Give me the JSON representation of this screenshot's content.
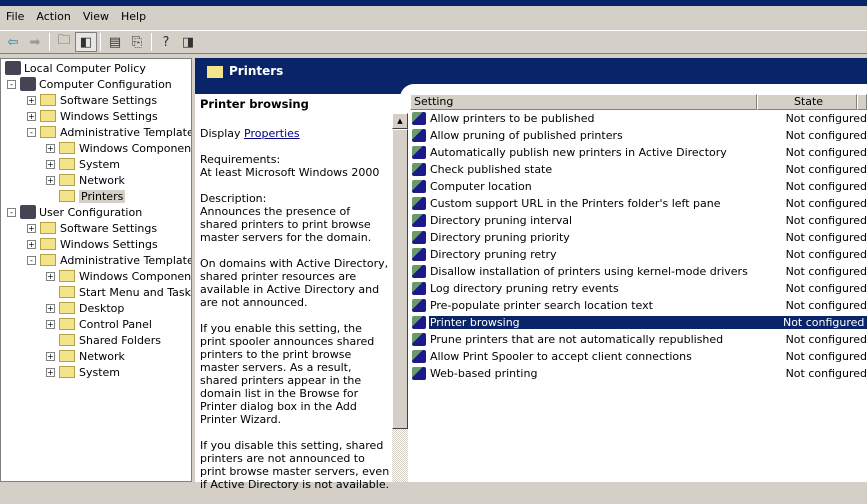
{
  "menu": [
    "File",
    "Action",
    "View",
    "Help"
  ],
  "toolbar": [
    "back-icon",
    "forward-icon",
    "up-folder-icon",
    "show-hide-tree-icon",
    "properties-icon",
    "export-list-icon",
    "help-icon",
    "show-hide-action-pane-icon"
  ],
  "tree": [
    {
      "label": "Local Computer Policy",
      "level": 0,
      "exp": ""
    },
    {
      "label": "Computer Configuration",
      "level": 1,
      "exp": "-"
    },
    {
      "label": "Software Settings",
      "level": 2,
      "exp": "+"
    },
    {
      "label": "Windows Settings",
      "level": 2,
      "exp": "+"
    },
    {
      "label": "Administrative Templates",
      "level": 2,
      "exp": "-"
    },
    {
      "label": "Windows Components",
      "level": 3,
      "exp": "+"
    },
    {
      "label": "System",
      "level": 3,
      "exp": "+"
    },
    {
      "label": "Network",
      "level": 3,
      "exp": "+"
    },
    {
      "label": "Printers",
      "level": 3,
      "exp": "",
      "selected": true
    },
    {
      "label": "User Configuration",
      "level": 1,
      "exp": "-"
    },
    {
      "label": "Software Settings",
      "level": 2,
      "exp": "+"
    },
    {
      "label": "Windows Settings",
      "level": 2,
      "exp": "+"
    },
    {
      "label": "Administrative Templates",
      "level": 2,
      "exp": "-"
    },
    {
      "label": "Windows Components",
      "level": 3,
      "exp": "+"
    },
    {
      "label": "Start Menu and Taskbar",
      "level": 3,
      "exp": ""
    },
    {
      "label": "Desktop",
      "level": 3,
      "exp": "+"
    },
    {
      "label": "Control Panel",
      "level": 3,
      "exp": "+"
    },
    {
      "label": "Shared Folders",
      "level": 3,
      "exp": ""
    },
    {
      "label": "Network",
      "level": 3,
      "exp": "+"
    },
    {
      "label": "System",
      "level": 3,
      "exp": "+"
    }
  ],
  "header": {
    "title": "Printers"
  },
  "desc": {
    "title": "Printer browsing",
    "display": "Display ",
    "link": "Properties ",
    "req_label": "Requirements:",
    "req": "At least Microsoft Windows 2000",
    "desc_label": "Description:",
    "p1": "Announces the presence of shared printers to print browse master servers for the domain.",
    "p2": "On domains with Active Directory, shared printer resources are available in Active Directory and are not announced.",
    "p3": "If you enable this setting, the print spooler announces shared printers to the print browse master servers. As a result, shared printers appear in the domain list in the Browse for Printer dialog box in the Add Printer Wizard.",
    "p4": "If you disable this setting, shared printers are not announced to print browse master servers, even if Active Directory is not available."
  },
  "columns": {
    "setting": "Setting",
    "state": "State"
  },
  "rows": [
    [
      "Allow printers to be published",
      "Not configured"
    ],
    [
      "Allow pruning of published printers",
      "Not configured"
    ],
    [
      "Automatically publish new printers in Active Directory",
      "Not configured"
    ],
    [
      "Check published state",
      "Not configured"
    ],
    [
      "Computer location",
      "Not configured"
    ],
    [
      "Custom support URL in the Printers folder's left pane",
      "Not configured"
    ],
    [
      "Directory pruning interval",
      "Not configured"
    ],
    [
      "Directory pruning priority",
      "Not configured"
    ],
    [
      "Directory pruning retry",
      "Not configured"
    ],
    [
      "Disallow installation of printers using kernel-mode drivers",
      "Not configured"
    ],
    [
      "Log directory pruning retry events",
      "Not configured"
    ],
    [
      "Pre-populate printer search location text",
      "Not configured"
    ],
    [
      "Printer browsing",
      "Not configured"
    ],
    [
      "Prune printers that are not automatically republished",
      "Not configured"
    ],
    [
      "Allow Print Spooler to accept client connections",
      "Not configured"
    ],
    [
      "Web-based printing",
      "Not configured"
    ]
  ],
  "selected_row": 12
}
